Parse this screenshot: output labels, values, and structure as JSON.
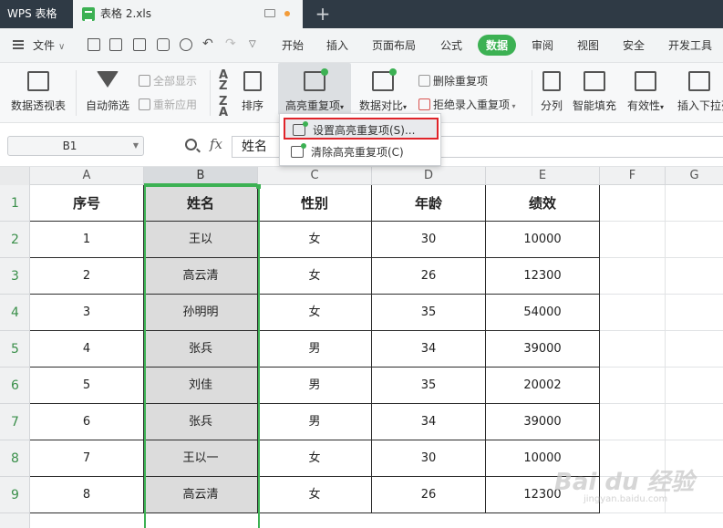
{
  "titlebar": {
    "app_name": "WPS 表格",
    "file_name": "表格 2.xls",
    "add_tab": "+"
  },
  "menubar": {
    "file_label": "文件",
    "items": [
      "开始",
      "插入",
      "页面布局",
      "公式",
      "数据",
      "审阅",
      "视图",
      "安全",
      "开发工具"
    ],
    "active": "数据"
  },
  "ribbon": {
    "pivot": "数据透视表",
    "auto_filter": "自动筛选",
    "show_all": "全部显示",
    "reapply": "重新应用",
    "sort": "排序",
    "highlight_dup": "高亮重复项",
    "data_compare": "数据对比",
    "remove_dup": "删除重复项",
    "reject_dup": "拒绝录入重复项",
    "split": "分列",
    "smart_fill": "智能填充",
    "validity": "有效性",
    "insert_dropdown": "插入下拉列"
  },
  "dropdown": {
    "set_highlight": "设置高亮重复项(S)...",
    "clear_highlight": "清除高亮重复项(C)"
  },
  "formula_bar": {
    "name_box": "B1",
    "fx": "fx",
    "value": "姓名"
  },
  "columns": [
    "A",
    "B",
    "C",
    "D",
    "E",
    "F",
    "G"
  ],
  "rows": [
    "1",
    "2",
    "3",
    "4",
    "5",
    "6",
    "7",
    "8",
    "9"
  ],
  "table": {
    "headers": [
      "序号",
      "姓名",
      "性别",
      "年龄",
      "绩效"
    ],
    "rows": [
      [
        "1",
        "王以",
        "女",
        "30",
        "10000"
      ],
      [
        "2",
        "高云清",
        "女",
        "26",
        "12300"
      ],
      [
        "3",
        "孙明明",
        "女",
        "35",
        "54000"
      ],
      [
        "4",
        "张兵",
        "男",
        "34",
        "39000"
      ],
      [
        "5",
        "刘佳",
        "男",
        "35",
        "20002"
      ],
      [
        "6",
        "张兵",
        "男",
        "34",
        "39000"
      ],
      [
        "7",
        "王以一",
        "女",
        "30",
        "10000"
      ],
      [
        "8",
        "高云清",
        "女",
        "26",
        "12300"
      ]
    ]
  },
  "watermark": {
    "brand": "Bai du 经验",
    "url": "jingyan.baidu.com"
  }
}
